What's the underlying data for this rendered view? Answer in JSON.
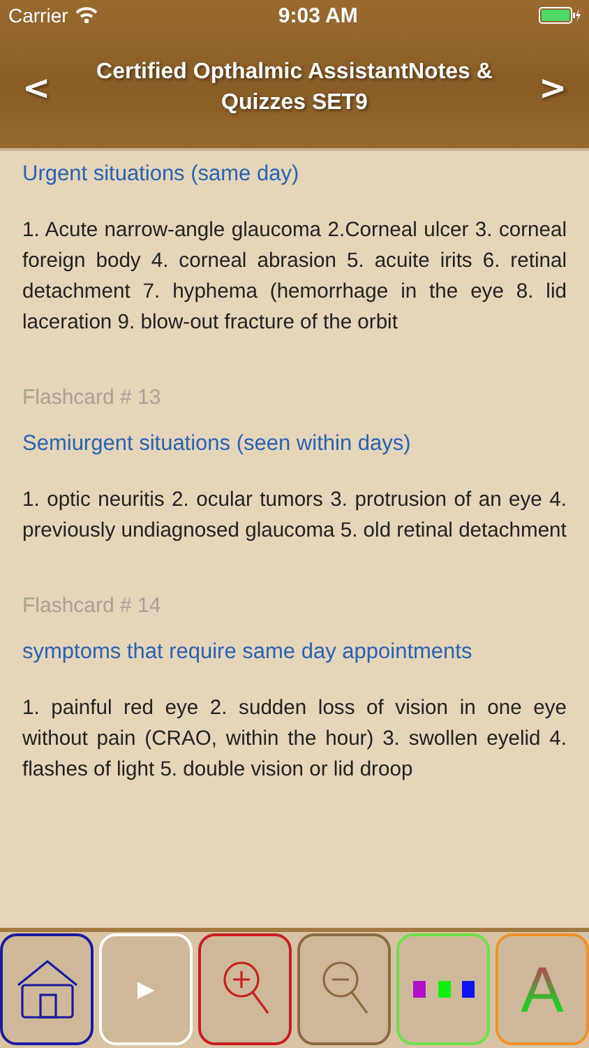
{
  "status_bar": {
    "carrier": "Carrier",
    "time": "9:03 AM"
  },
  "header": {
    "title": "Certified Opthalmic AssistantNotes & Quizzes SET9",
    "prev": "<",
    "next": ">"
  },
  "cards": [
    {
      "question": "Urgent situations (same day)",
      "answer": "1. Acute narrow-angle glaucoma 2.Corneal ulcer 3. corneal foreign body 4. corneal abrasion 5. acuite irits 6. retinal detachment 7. hyphema (hemorrhage in the eye 8. lid laceration 9. blow-out fracture of the orbit"
    },
    {
      "label": "Flashcard # 13",
      "question": "Semiurgent situations (seen within days)",
      "answer": "1. optic neuritis 2. ocular tumors 3. protrusion of an eye 4. previously undiagnosed glaucoma 5. old retinal detachment"
    },
    {
      "label": "Flashcard # 14",
      "question": "symptoms that require same day appointments",
      "answer": "1. painful red eye 2. sudden loss of vision in one eye without pain (CRAO, within the hour) 3. swollen eyelid 4. flashes of light 5. double vision or lid droop"
    }
  ],
  "toolbar": [
    {
      "kind": "home",
      "color": "#1a1aa0"
    },
    {
      "kind": "play",
      "color": "#ffffff",
      "glyph": "▶"
    },
    {
      "kind": "zoom-in",
      "color": "#c81e1e"
    },
    {
      "kind": "zoom-out",
      "color": "#8a6a40"
    },
    {
      "kind": "colors",
      "color": "#6ee04a"
    },
    {
      "kind": "font",
      "color": "#f0902a",
      "glyph": "A"
    }
  ]
}
